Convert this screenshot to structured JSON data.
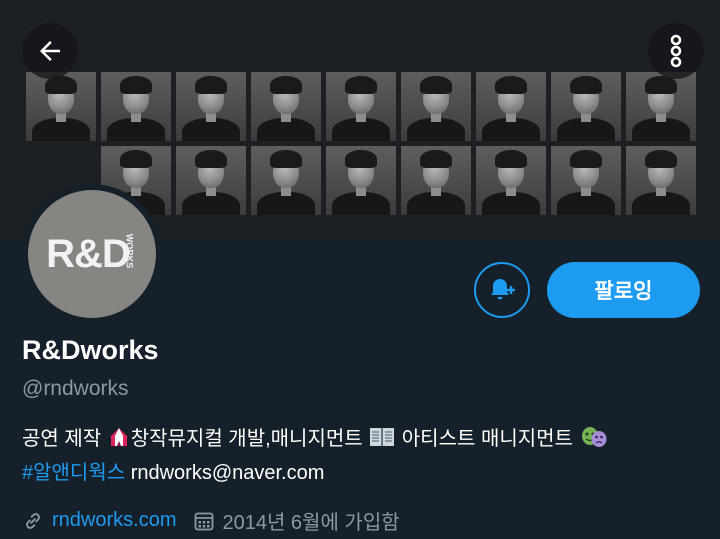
{
  "banner": {
    "description_icons": [
      "back-arrow-icon",
      "more-vertical-icon"
    ]
  },
  "profile": {
    "avatar_logo_main": "R&D",
    "avatar_logo_side": "WORKS",
    "name": "R&Dworks",
    "handle": "@rndworks",
    "bio_part1": "공연 제작",
    "bio_part2": "창작뮤지컬 개발,매니지먼트",
    "bio_part3": "아티스트 매니지먼트",
    "hashtag": "#알앤디웍스",
    "email": "rndworks@naver.com",
    "link": "rndworks.com",
    "joined": "2014년 6월에 가입함"
  },
  "actions": {
    "follow_label": "팔로잉",
    "bell_icon": "bell-plus-icon"
  },
  "colors": {
    "accent": "#1d9bf0",
    "background": "#15202b",
    "secondary_text": "#8b98a5"
  }
}
